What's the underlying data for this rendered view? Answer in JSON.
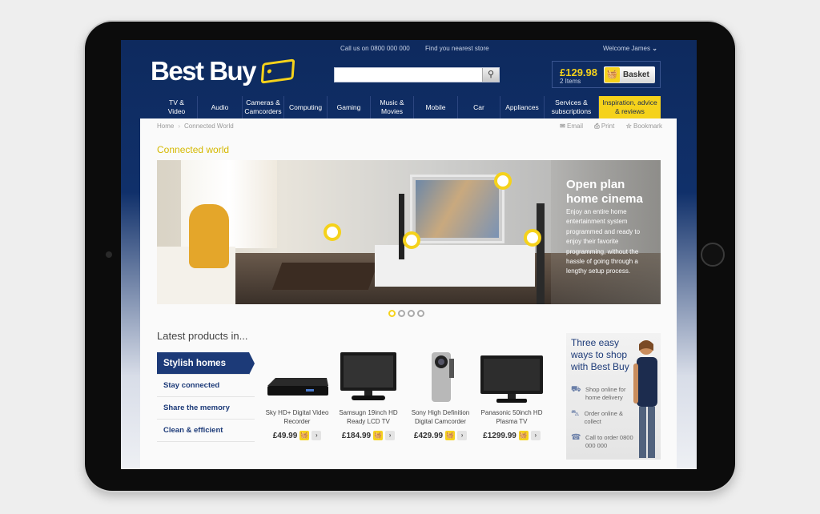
{
  "topbar": {
    "phone": "Call us on 0800 000 000",
    "store": "Find you nearest store",
    "welcome": "Welcome James"
  },
  "logo": {
    "text": "Best Buy"
  },
  "search": {
    "placeholder": ""
  },
  "basket": {
    "price": "£129.98",
    "items": "2 Items",
    "label": "Basket"
  },
  "nav": [
    {
      "label": "TV &\nVideo",
      "w": 52
    },
    {
      "label": "Audio",
      "w": 56
    },
    {
      "label": "Cameras &\nCamcorders",
      "w": 52
    },
    {
      "label": "Computing",
      "w": 54
    },
    {
      "label": "Gaming",
      "w": 54
    },
    {
      "label": "Music &\nMovies",
      "w": 54
    },
    {
      "label": "Mobile",
      "w": 55
    },
    {
      "label": "Car",
      "w": 53
    },
    {
      "label": "Appliances",
      "w": 55
    },
    {
      "label": "Services &\nsubscriptions",
      "w": 68
    },
    {
      "label": "Inspiration, advice\n& reviews",
      "w": 77
    }
  ],
  "breadcrumb": {
    "home": "Home",
    "current": "Connected World"
  },
  "tools": {
    "email": "Email",
    "print": "Print",
    "bookmark": "Bookmark"
  },
  "section_title": "Connected world",
  "hero": {
    "title": "Open plan\nhome cinema",
    "text": "Enjoy an entire home entertainment system programmed and ready to enjoy their favorite programming, without the hassle of going through a lengthy setup process.",
    "active_slide": 1,
    "slides": 4
  },
  "latest": {
    "title": "Latest products in...",
    "tabs": [
      "Stylish homes",
      "Stay connected",
      "Share the memory",
      "Clean & efficient"
    ]
  },
  "products": [
    {
      "name": "Sky HD+ Digital Video Recorder",
      "price": "£49.99",
      "icon": "recorder"
    },
    {
      "name": "Samsugn 19inch HD Ready LCD TV",
      "price": "£184.99",
      "icon": "tv"
    },
    {
      "name": "Sony High Definition Digital Camcorder",
      "price": "£429.99",
      "icon": "camcorder"
    },
    {
      "name": "Panasonic 50inch HD Plasma TV",
      "price": "£1299.99",
      "icon": "plasma"
    }
  ],
  "promo": {
    "title": "Three easy\nways to shop\nwith Best Buy",
    "lines": [
      "Shop online for home delivery",
      "Order online & collect",
      "Call to order 0800 000 000"
    ]
  },
  "colors": {
    "navy": "#1c3a78",
    "yellow": "#f5d21b"
  }
}
